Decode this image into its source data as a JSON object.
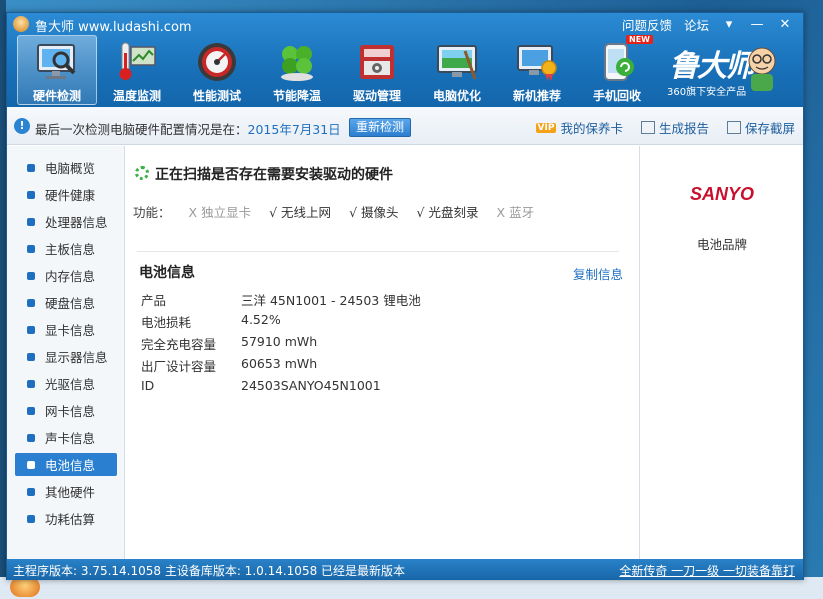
{
  "app": {
    "title": "鲁大师 www.ludashi.com"
  },
  "titlebar": {
    "feedback": "问题反馈",
    "forum": "论坛",
    "menu_icon": "dropdown-arrow-icon",
    "minimize_icon": "minimize-icon",
    "close_icon": "close-icon"
  },
  "toolbar": {
    "items": [
      {
        "label": "硬件检测",
        "icon": "monitor-magnifier-icon"
      },
      {
        "label": "温度监测",
        "icon": "thermometer-icon"
      },
      {
        "label": "性能测试",
        "icon": "speedometer-icon"
      },
      {
        "label": "节能降温",
        "icon": "clover-icon"
      },
      {
        "label": "驱动管理",
        "icon": "gear-box-icon"
      },
      {
        "label": "电脑优化",
        "icon": "screen-broom-icon"
      },
      {
        "label": "新机推荐",
        "icon": "monitor-medal-icon"
      },
      {
        "label": "手机回收",
        "icon": "phone-recycle-icon",
        "badge": "NEW"
      }
    ]
  },
  "brand": {
    "name": "鲁大师",
    "sub": "360旗下安全产品"
  },
  "infobar": {
    "text": "最后一次检测电脑硬件配置情况是在：",
    "date": "2015年7月31日",
    "recheck": "重新检测",
    "vip_badge": "VIP",
    "warranty": "我的保养卡",
    "report": "生成报告",
    "screenshot": "保存截屏"
  },
  "sidebar": {
    "items": [
      {
        "label": "电脑概览"
      },
      {
        "label": "硬件健康"
      },
      {
        "label": "处理器信息"
      },
      {
        "label": "主板信息"
      },
      {
        "label": "内存信息"
      },
      {
        "label": "硬盘信息"
      },
      {
        "label": "显卡信息"
      },
      {
        "label": "显示器信息"
      },
      {
        "label": "光驱信息"
      },
      {
        "label": "网卡信息"
      },
      {
        "label": "声卡信息"
      },
      {
        "label": "电池信息"
      },
      {
        "label": "其他硬件"
      },
      {
        "label": "功耗估算"
      }
    ],
    "active_index": 11
  },
  "main": {
    "scan_title": "正在扫描是否存在需要安装驱动的硬件",
    "func_label": "功能：",
    "functions": [
      {
        "mark": "X",
        "label": "独立显卡"
      },
      {
        "mark": "√",
        "label": "无线上网"
      },
      {
        "mark": "√",
        "label": "摄像头"
      },
      {
        "mark": "√",
        "label": "光盘刻录"
      },
      {
        "mark": "X",
        "label": "蓝牙"
      }
    ],
    "section_title": "电池信息",
    "copy_link": "复制信息",
    "rows": [
      {
        "k": "产品",
        "v": "三洋 45N1001 - 24503 锂电池"
      },
      {
        "k": "电池损耗",
        "v": "4.52%"
      },
      {
        "k": "完全充电容量",
        "v": "57910 mWh"
      },
      {
        "k": "出厂设计容量",
        "v": "60653 mWh"
      },
      {
        "k": "ID",
        "v": "24503SANYO45N1001"
      }
    ]
  },
  "rightpanel": {
    "logo": "SANYO",
    "label": "电池品牌"
  },
  "statusbar": {
    "left": "主程序版本: 3.75.14.1058   主设备库版本: 1.0.14.1058   已经是最新版本",
    "right": "全新传奇 一刀一级 一切装备靠打"
  }
}
